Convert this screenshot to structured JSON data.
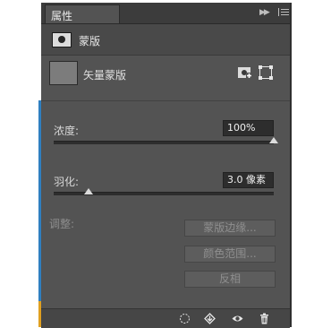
{
  "panel": {
    "tab_title": "属性",
    "header_title": "蒙版",
    "vector_mask_label": "矢量蒙版",
    "density": {
      "label": "浓度:",
      "value": "100%",
      "level_percent": 100
    },
    "feather": {
      "label": "羽化:",
      "value": "3.0 像素",
      "level_percent": 16
    },
    "adjust_label": "调整:",
    "buttons": {
      "mask_edge": "蒙版边缘...",
      "color_range": "颜色范围...",
      "invert": "反相"
    }
  },
  "icons": {
    "collapse": "double-chevron-right-icon",
    "menu": "panel-menu-icon",
    "mask": "layer-mask-icon",
    "add_mask": "add-pixel-mask-icon",
    "select_vector": "vector-mask-select-icon",
    "load_selection": "load-selection-icon",
    "apply_mask": "apply-mask-icon",
    "toggle_visibility": "eye-icon",
    "delete": "trash-icon"
  },
  "colors": {
    "panel_bg": "#535353",
    "accent_blue": "#2f7fc1",
    "accent_orange": "#e0a020"
  }
}
